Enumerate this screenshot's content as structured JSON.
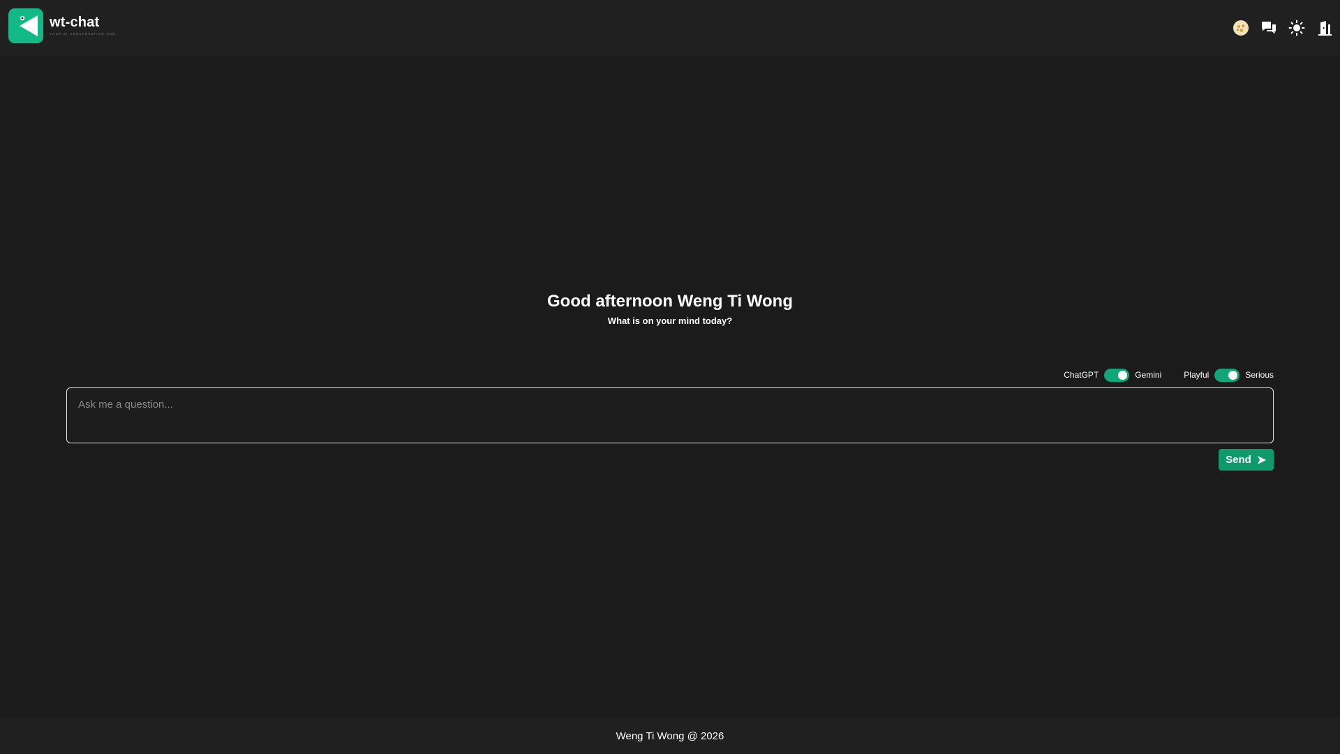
{
  "header": {
    "brand_name": "wt-chat",
    "brand_tagline": "your ai conversation hub",
    "icons": [
      "avatar-icon",
      "chat-history-icon",
      "sun-icon",
      "logout-door-icon"
    ]
  },
  "main": {
    "greeting": "Good afternoon Weng Ti Wong",
    "subtitle": "What is on your mind today?",
    "model_toggle": {
      "left_label": "ChatGPT",
      "right_label": "Gemini",
      "state": "on"
    },
    "tone_toggle": {
      "left_label": "Playful",
      "right_label": "Serious",
      "state": "on"
    },
    "question_placeholder": "Ask me a question...",
    "question_value": "",
    "send_label": "Send"
  },
  "footer": {
    "text": "Weng Ti Wong @ 2026"
  },
  "colors": {
    "background": "#1b1b1b",
    "header_bg": "#202020",
    "accent": "#12b886",
    "button": "#0f9a6c"
  }
}
